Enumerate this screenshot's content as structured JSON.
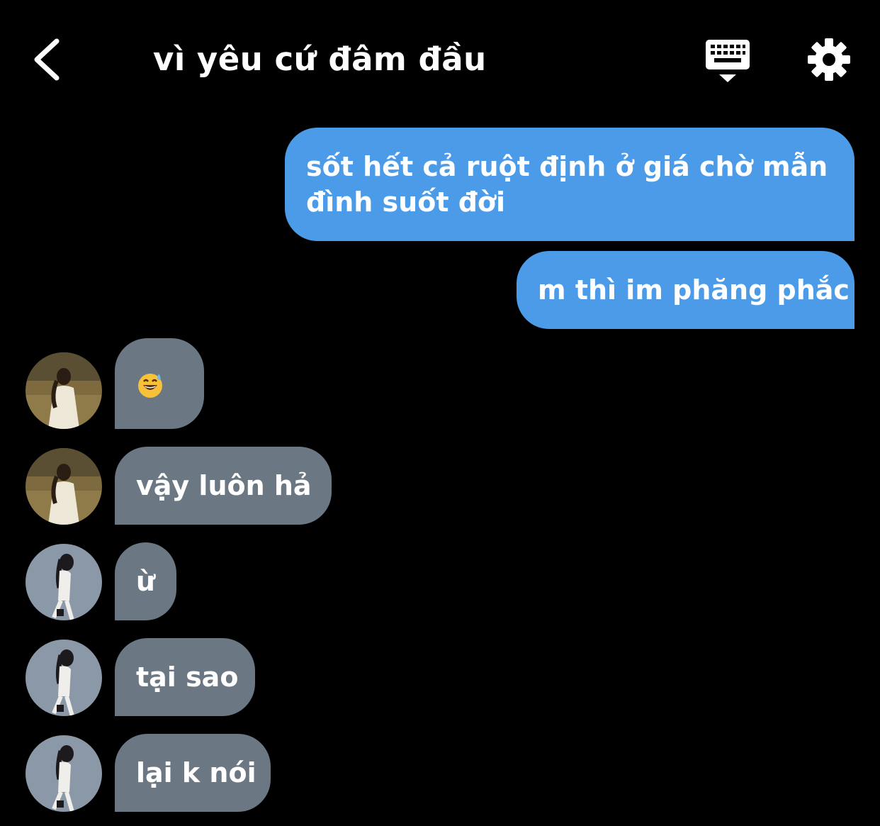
{
  "header": {
    "title": "vì yêu cứ đâm đầu",
    "back_icon": "chevron-left-icon",
    "keyboard_icon": "keyboard-icon",
    "settings_icon": "gear-icon"
  },
  "colors": {
    "background": "#000000",
    "sent_bubble": "#4c9be8",
    "received_bubble": "#6b7783",
    "text": "#ffffff"
  },
  "messages": [
    {
      "direction": "sent",
      "text": "sốt hết cả ruột định ở giá chờ mẫn\nđình suốt đời"
    },
    {
      "direction": "sent",
      "text": "m thì im phăng phắc"
    },
    {
      "direction": "received",
      "avatar": "avatar-field",
      "emoji": "grinning-sweat-emoji"
    },
    {
      "direction": "received",
      "avatar": "avatar-field",
      "text": "vậy luôn hả"
    },
    {
      "direction": "received",
      "avatar": "avatar-studio",
      "text": "ừ"
    },
    {
      "direction": "received",
      "avatar": "avatar-studio",
      "text": "tại sao"
    },
    {
      "direction": "received",
      "avatar": "avatar-studio",
      "text": "lại k nói"
    }
  ]
}
